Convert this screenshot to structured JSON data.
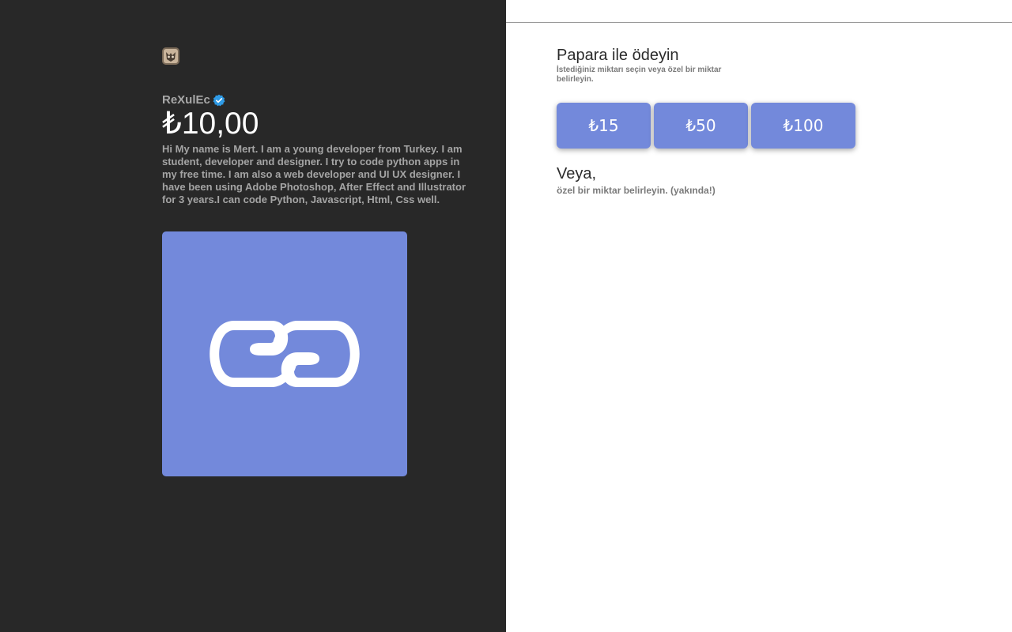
{
  "creator": {
    "name": "ReXulEc",
    "price": "₺10,00",
    "bio": "Hi  My name is Mert. I am a young developer from Turkey. I am student, developer and designer. I try to code python apps in my free time. I am also a web developer and UI UX designer. I have been using Adobe Photoshop, After Effect and Illustrator for 3 years.I can code Python, Javascript, Html, Css well."
  },
  "payment": {
    "title": "Papara ile ödeyin",
    "subtitle": "İstediğiniz miktarı seçin veya özel bir miktar belirleyin.",
    "amounts": [
      "₺15",
      "₺50",
      "₺100"
    ],
    "or_title": "Veya,",
    "or_subtitle": "özel bir miktar belirleyin. (yakında!)"
  },
  "colors": {
    "left_background": "#282828",
    "accent": "#7389db",
    "verified": "#2f9be6"
  },
  "icons": {
    "verified": "verified-check-icon",
    "link": "link-chain-icon"
  }
}
